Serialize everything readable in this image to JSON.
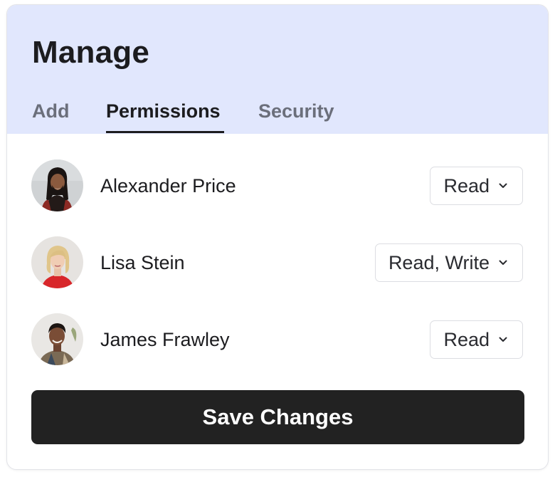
{
  "card": {
    "title": "Manage",
    "tabs": [
      {
        "label": "Add",
        "active": false
      },
      {
        "label": "Permissions",
        "active": true
      },
      {
        "label": "Security",
        "active": false
      }
    ]
  },
  "members": [
    {
      "name": "Alexander Price",
      "permission": "Read",
      "avatar_icon": "avatar-photo"
    },
    {
      "name": "Lisa Stein",
      "permission": "Read, Write",
      "avatar_icon": "avatar-photo"
    },
    {
      "name": "James Frawley",
      "permission": "Read",
      "avatar_icon": "avatar-photo"
    }
  ],
  "actions": {
    "save_label": "Save Changes"
  },
  "colors": {
    "header_bg": "#e1e7fd",
    "primary_button": "#222222",
    "active_tab": "#1c1c1f",
    "inactive_tab": "#6b6f7b"
  },
  "icons": {
    "dropdown": "chevron-down-icon"
  }
}
